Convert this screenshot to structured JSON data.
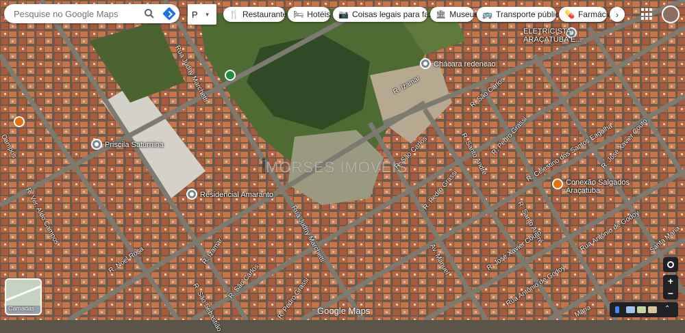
{
  "search": {
    "placeholder": "Pesquise no Google Maps"
  },
  "dropdown": {
    "label": "P"
  },
  "chips": [
    {
      "icon": "restaurant-icon",
      "glyph": "🍴",
      "label": "Restaurantes"
    },
    {
      "icon": "hotel-icon",
      "glyph": "🛏",
      "label": "Hotéis"
    },
    {
      "icon": "camera-icon",
      "glyph": "📷",
      "label": "Coisas legais para fazer"
    },
    {
      "icon": "museum-icon",
      "glyph": "🏛",
      "label": "Museus"
    },
    {
      "icon": "transit-icon",
      "glyph": "🚌",
      "label": "Transporte público"
    },
    {
      "icon": "pharmacy-icon",
      "glyph": "💊",
      "label": "Farmácias"
    }
  ],
  "places": {
    "eletricista_1": "ELETRICISTA",
    "eletricista_2": "ARAÇATUBA E...",
    "chacara": "Chácara redencao",
    "priscila": "Priscila Saturnina",
    "residencial": "Residencial Amaranto",
    "conexao_1": "Conexão Salgados",
    "conexao_2": "Araçatuba"
  },
  "streets": {
    "judhy_1": "Rua Judhy Marchetti",
    "judhy_2": "Rua Judhy Marchetti",
    "izamar_1": "R. Izamar",
    "izamar_2": "R. Izamar",
    "sao_carlos_1": "R. São Carlos",
    "sao_carlos_2": "R. São Carlos",
    "sao_carlos_3": "R. São Carlos",
    "santo_andre_1": "R. Santo André",
    "santo_andre_2": "R. Santo André",
    "pedro_grassi_1": "R. Pedro Grassi",
    "pedro_grassi_2": "R. Pedro Grassi",
    "pedro_grassi_3": "R. Pedro Grassi",
    "celestino": "R. Celestino dos Santos Eagalha",
    "jose_xavier_1": "R. José Xavier Couto",
    "jose_xavier_2": "R. José Xavier Couto",
    "antonio_1": "Rua Antônio de Godoy",
    "antonio_2": "Rua Antônio de Godoy",
    "aldo": "R. Ver. Aldo Campos",
    "noel": "R. Noel Rosa",
    "sebastiao": "R. São Sebastião",
    "campos": "Campos",
    "manuel": "Av. Manuel",
    "santa_maria": "Santa Maria",
    "maria": "Maria"
  },
  "watermark": "MORSES IMOVEIS",
  "layers_label": "Camadas",
  "brand": "Google Maps",
  "colors": {
    "accent": "#1a73e8",
    "pin_gray": "#7a8692",
    "pin_green": "#1e8e3e",
    "pin_orange": "#e8710a"
  }
}
